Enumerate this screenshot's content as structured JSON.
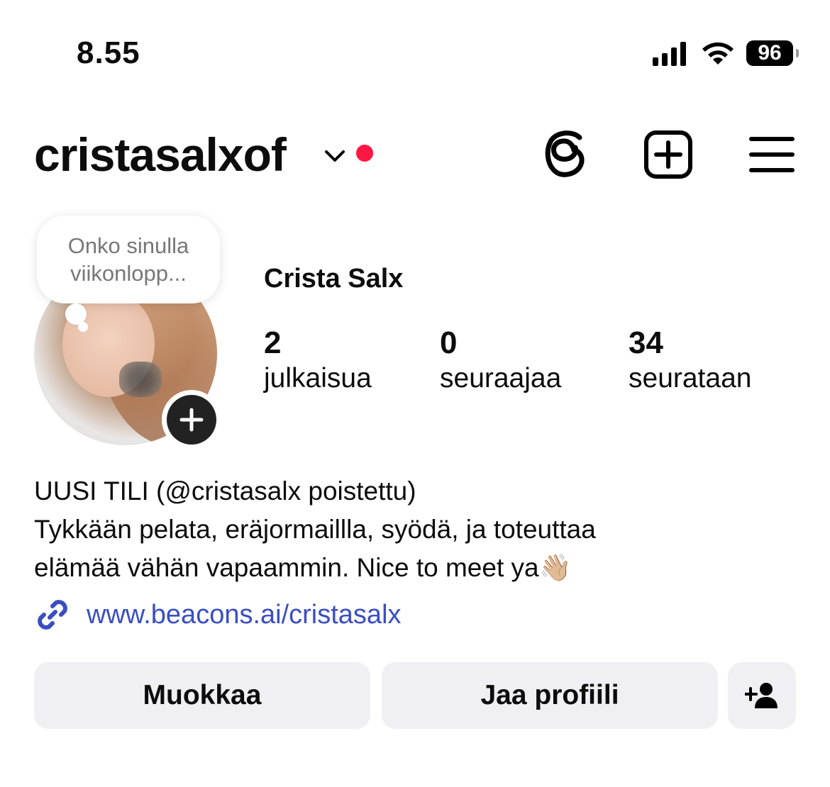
{
  "status_bar": {
    "time": "8.55",
    "battery": "96"
  },
  "header": {
    "username": "cristasalxof",
    "notification_color": "#ff1744",
    "icons": [
      "threads-icon",
      "create-post-icon",
      "menu-icon"
    ]
  },
  "profile": {
    "note": "Onko sinulla viikonlopp...",
    "full_name": "Crista Salx",
    "stats": [
      {
        "value": "2",
        "label": "julkaisua"
      },
      {
        "value": "0",
        "label": "seuraajaa"
      },
      {
        "value": "34",
        "label": "seurataan"
      }
    ],
    "bio_lines": [
      "UUSI TILI (@cristasalx poistettu)",
      "Tykkään pelata, eräjormaillla, syödä, ja toteuttaa",
      "elämää vähän vapaammin. Nice to meet ya👋🏼"
    ],
    "link": "www.beacons.ai/cristasalx"
  },
  "actions": {
    "edit_label": "Muokkaa",
    "share_label": "Jaa profiili",
    "accent_link_color": "#3a4ec2"
  }
}
